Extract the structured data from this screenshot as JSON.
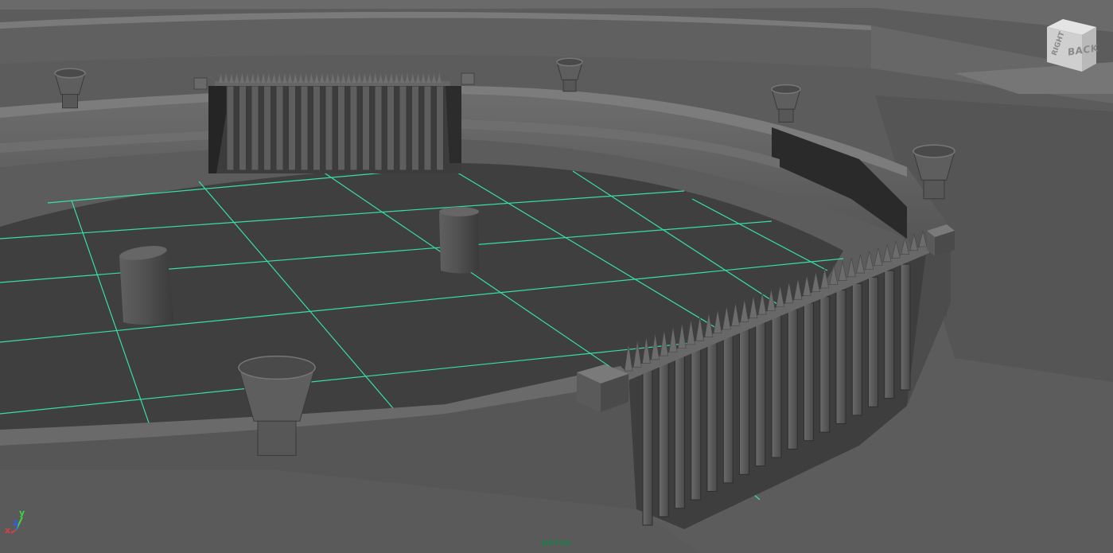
{
  "viewport": {
    "camera_name": "persp",
    "viewcube": {
      "face_label": "BACK",
      "side_label": "RIGHT"
    },
    "axes": {
      "x_label": "x",
      "y_label": "y",
      "z_label": "z"
    }
  },
  "colors": {
    "grid_line": "#37e6b0",
    "background": "#5a5a5a",
    "floor": "#3d3d3d",
    "camera_label": "#1f7a4a",
    "axis_x": "#d84040",
    "axis_y": "#3ed24a",
    "axis_z": "#3a5ae0"
  }
}
